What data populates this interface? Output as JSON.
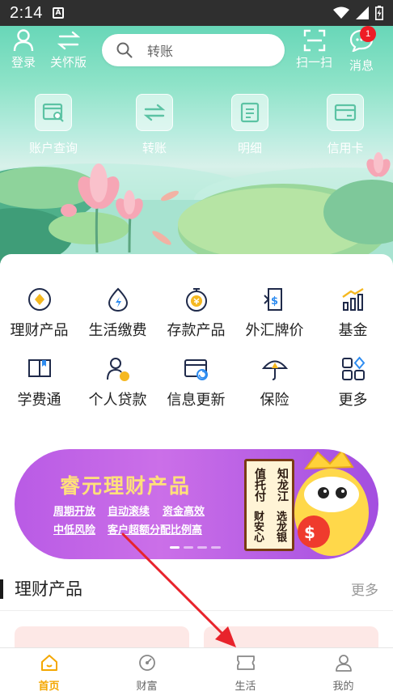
{
  "status_bar": {
    "time": "2:14",
    "notice_glyph": "A"
  },
  "top_bar": {
    "login_label": "登录",
    "care_mode_label": "关怀版",
    "search_placeholder": "转账",
    "scan_label": "扫一扫",
    "messages_label": "消息",
    "messages_badge": "1"
  },
  "quick_actions": [
    {
      "label": "账户查询",
      "icon": "account-query-icon"
    },
    {
      "label": "转账",
      "icon": "transfer-icon"
    },
    {
      "label": "明细",
      "icon": "details-icon"
    },
    {
      "label": "信用卡",
      "icon": "credit-card-icon"
    }
  ],
  "services": [
    {
      "label": "理财产品",
      "icon": "wealth-product-icon"
    },
    {
      "label": "生活缴费",
      "icon": "utility-bill-icon"
    },
    {
      "label": "存款产品",
      "icon": "deposit-icon"
    },
    {
      "label": "外汇牌价",
      "icon": "forex-rate-icon"
    },
    {
      "label": "基金",
      "icon": "fund-chart-icon"
    },
    {
      "label": "学费通",
      "icon": "tuition-book-icon"
    },
    {
      "label": "个人贷款",
      "icon": "personal-loan-icon"
    },
    {
      "label": "信息更新",
      "icon": "info-update-icon"
    },
    {
      "label": "保险",
      "icon": "insurance-umbrella-icon"
    },
    {
      "label": "更多",
      "icon": "more-apps-icon"
    }
  ],
  "banner": {
    "title": "睿元理财产品",
    "lines": [
      "周期开放",
      "自动滚续",
      "资金高效",
      "中低风险",
      "客户超额分配比例高"
    ],
    "scroll_right": "知龙江",
    "scroll_mid_right": "选龙银",
    "scroll_mid_left": "值托付",
    "scroll_left": "财安心",
    "slide_count": 4,
    "active_slide": 0,
    "colors": {
      "background": "#b95be5",
      "title": "#ffe07a"
    }
  },
  "section": {
    "title": "理财产品",
    "more": "更多"
  },
  "tabs": [
    {
      "label": "首页",
      "icon": "home-icon",
      "active": true
    },
    {
      "label": "财富",
      "icon": "wealth-icon",
      "active": false
    },
    {
      "label": "生活",
      "icon": "life-ticket-icon",
      "active": false
    },
    {
      "label": "我的",
      "icon": "profile-icon",
      "active": false
    }
  ],
  "colors": {
    "accent": "#f4a700",
    "hero": "#68d7b8",
    "badge": "#ee1c25",
    "arrow": "#e8232b"
  }
}
